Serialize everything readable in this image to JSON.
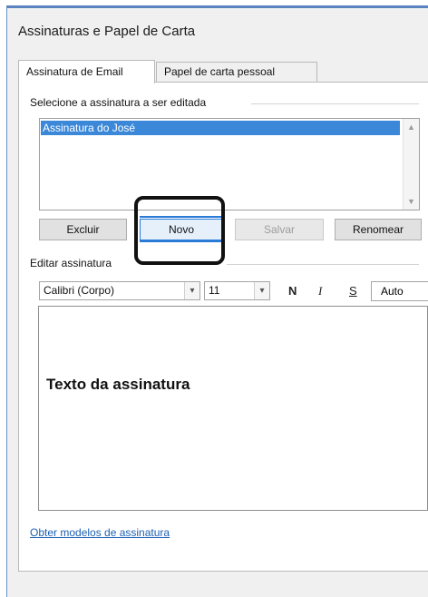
{
  "window": {
    "title": "Assinaturas e Papel de Carta"
  },
  "tabs": [
    {
      "label": "Assinatura de Email",
      "active": true
    },
    {
      "label": "Papel de carta pessoal",
      "active": false
    }
  ],
  "signature_select": {
    "label": "Selecione a assinatura a ser editada",
    "items": [
      "Assinatura do José"
    ],
    "selected": "Assinatura do José"
  },
  "buttons": {
    "delete": "Excluir",
    "new": "Novo",
    "save": "Salvar",
    "rename": "Renomear"
  },
  "editor": {
    "label": "Editar assinatura",
    "font": "Calibri (Corpo)",
    "size": "11",
    "bold": "N",
    "italic": "I",
    "underline": "S",
    "color": "Auto",
    "content": "Texto da assinatura"
  },
  "templates_link": "Obter modelos de assinatura",
  "colors": {
    "selection": "#3b88d8",
    "link": "#1b5fb4",
    "callout": "#111111"
  }
}
